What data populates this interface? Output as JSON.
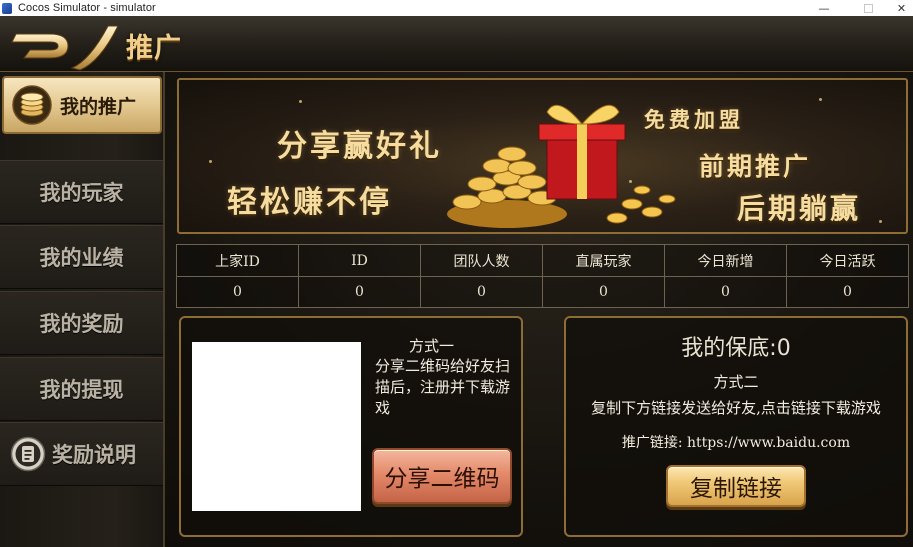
{
  "window": {
    "title": "Cocos Simulator - simulator",
    "controls": [
      "minimize",
      "maximize",
      "close"
    ]
  },
  "header": {
    "title": "推广",
    "back_icon": "back-arrow-icon"
  },
  "sidebar": {
    "items": [
      {
        "label": "我的推广",
        "active": true,
        "icon": "coin-stack-icon"
      },
      {
        "label": "我的玩家",
        "active": false
      },
      {
        "label": "我的业绩",
        "active": false
      },
      {
        "label": "我的奖励",
        "active": false
      },
      {
        "label": "我的提现",
        "active": false
      },
      {
        "label": "奖励说明",
        "active": false,
        "icon": "document-icon"
      }
    ]
  },
  "banner": {
    "line1": "分享赢好礼",
    "line2": "轻松赚不停",
    "line3": "免费加盟",
    "line4": "前期推广",
    "line5": "后期躺赢"
  },
  "stats": {
    "headers": [
      "上家ID",
      "ID",
      "团队人数",
      "直属玩家",
      "今日新增",
      "今日活跃"
    ],
    "values": [
      "0",
      "0",
      "0",
      "0",
      "0",
      "0"
    ]
  },
  "method1": {
    "title": "方式一",
    "description": "分享二维码给好友扫描后，注册并下载游戏",
    "button": "分享二维码"
  },
  "method2": {
    "guarantee": "我的保底:0",
    "title": "方式二",
    "description": "复制下方链接发送给好友,点击链接下载游戏",
    "link": "推广链接: https://www.baidu.com",
    "button": "复制链接"
  },
  "colors": {
    "gold": "#f1cf8a",
    "panel_border": "#8d6c35",
    "background": "#16130e"
  }
}
